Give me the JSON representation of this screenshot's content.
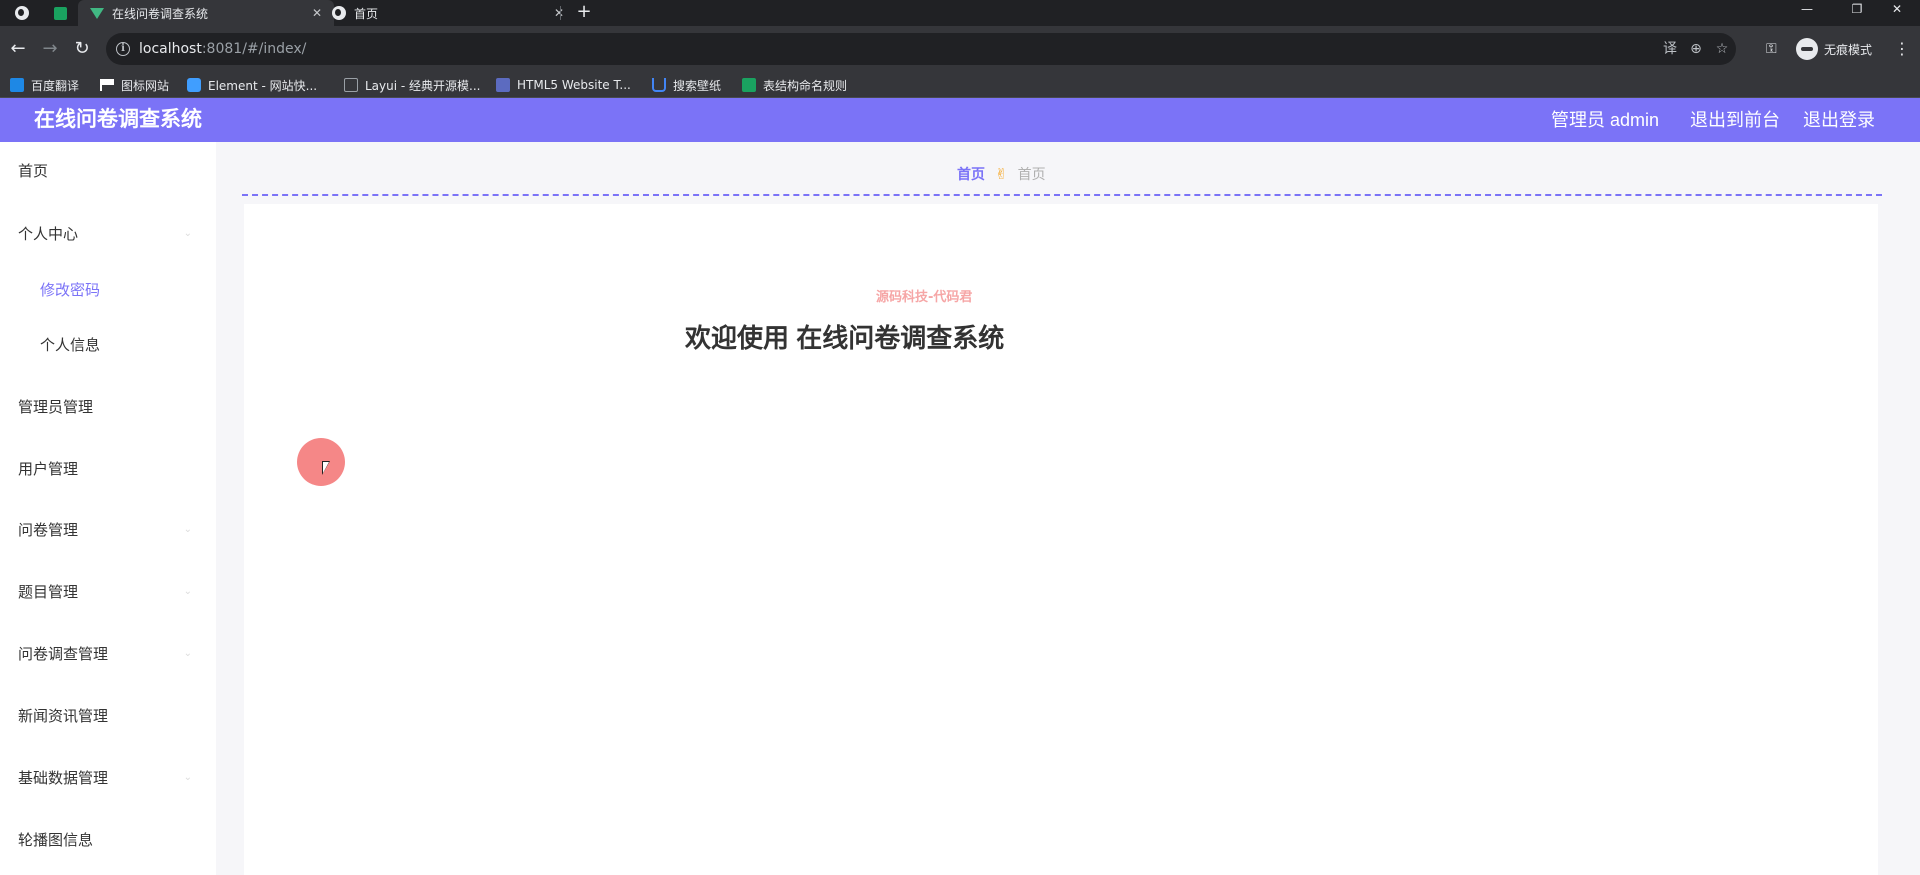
{
  "browser": {
    "tabs": [
      {
        "title": "在线问卷调查系统",
        "close": "✕"
      },
      {
        "title": "首页",
        "close": "✕"
      }
    ],
    "new_tab": "+",
    "window_controls": {
      "minimize": "—",
      "restore": "❐",
      "close": "✕"
    },
    "nav": {
      "back": "←",
      "forward": "→",
      "reload": "↻"
    },
    "url": {
      "host": "localhost",
      "rest": ":8081/#/index/"
    },
    "omnibox_icons": {
      "translate": "译",
      "zoom": "⊕",
      "bookmark": "☆"
    },
    "key_icon": "⚿",
    "incognito_label": "无痕模式",
    "menu_icon": "⋮",
    "bookmarks": [
      {
        "label": "百度翻译",
        "color": "#1e88e5"
      },
      {
        "label": "图标网站",
        "color": "#ffffff"
      },
      {
        "label": "Element - 网站快...",
        "color": "#409eff"
      },
      {
        "label": "Layui - 经典开源模...",
        "color": "#35363a"
      },
      {
        "label": "HTML5 Website T...",
        "color": "#5c6bc0"
      },
      {
        "label": "搜索壁纸",
        "color": "#4285f4"
      },
      {
        "label": "表结构命名规则",
        "color": "#1aa260"
      }
    ]
  },
  "app": {
    "title": "在线问卷调查系统",
    "header_links": [
      "管理员 admin",
      "退出到前台",
      "退出登录"
    ],
    "accent": "#7b73f7",
    "sidebar": [
      {
        "label": "首页",
        "arrow": ""
      },
      {
        "label": "个人中心",
        "arrow": "⌄"
      },
      {
        "label": "修改密码",
        "arrow": ""
      },
      {
        "label": "个人信息",
        "arrow": ""
      },
      {
        "label": "管理员管理",
        "arrow": ""
      },
      {
        "label": "用户管理",
        "arrow": ""
      },
      {
        "label": "问卷管理",
        "arrow": "⌄"
      },
      {
        "label": "题目管理",
        "arrow": "⌄"
      },
      {
        "label": "问卷调查管理",
        "arrow": "⌄"
      },
      {
        "label": "新闻资讯管理",
        "arrow": ""
      },
      {
        "label": "基础数据管理",
        "arrow": "⌄"
      },
      {
        "label": "轮播图信息",
        "arrow": ""
      }
    ],
    "breadcrumb": {
      "home": "首页",
      "separator": "✌",
      "current": "首页"
    },
    "watermark": "源码科技-代码君",
    "welcome": "欢迎使用 在线问卷调查系统"
  }
}
